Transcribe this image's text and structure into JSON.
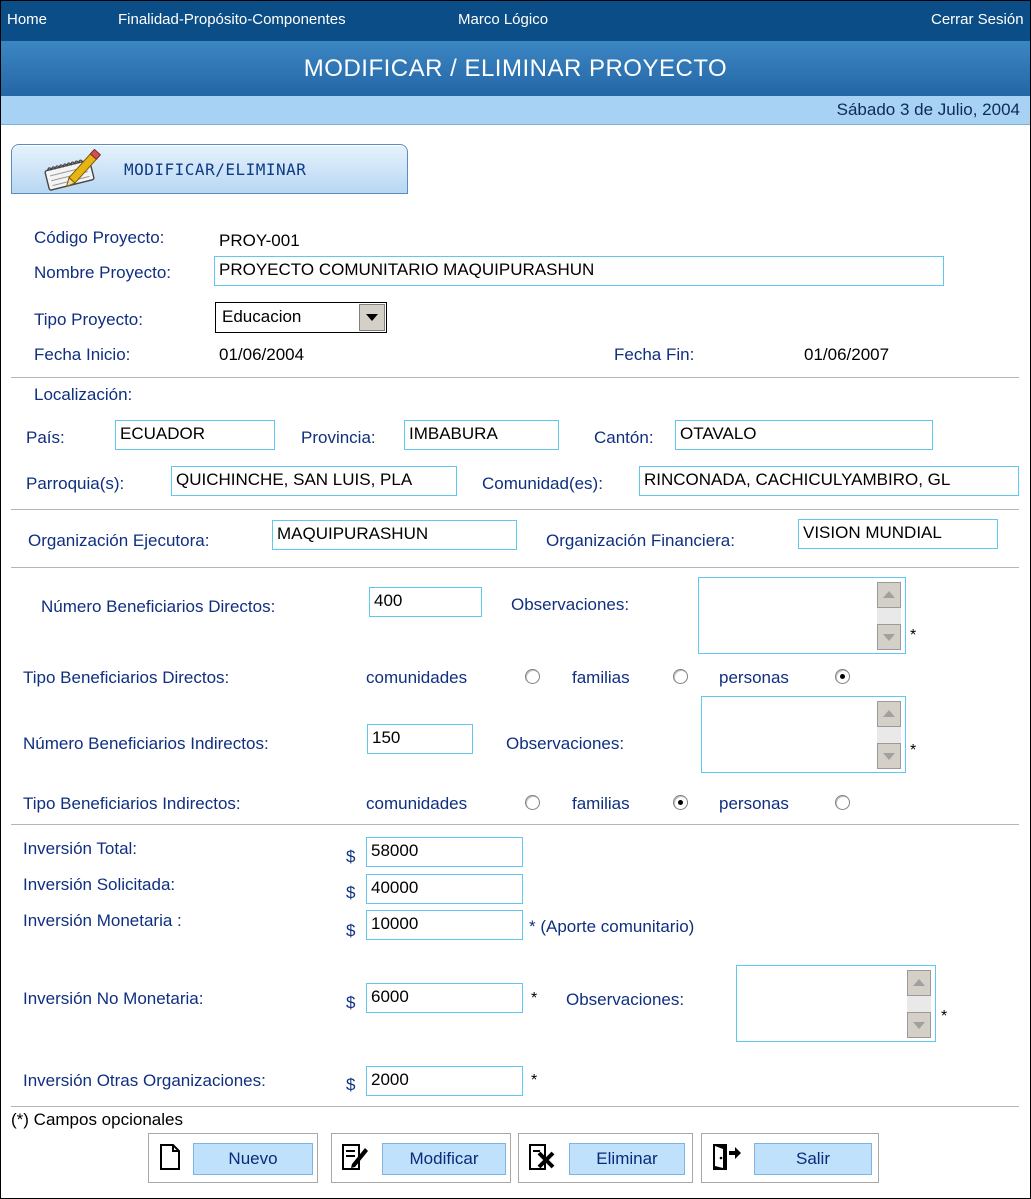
{
  "nav": {
    "home": "Home",
    "finalidad": "Finalidad-Propósito-Componentes",
    "marco": "Marco Lógico",
    "logout": "Cerrar Sesión"
  },
  "header": {
    "title": "MODIFICAR / ELIMINAR PROYECTO",
    "date": "Sábado 3 de Julio, 2004"
  },
  "tab": {
    "title": "MODIFICAR/ELIMINAR"
  },
  "form": {
    "codigo_label": "Código Proyecto:",
    "codigo_value": "PROY-001",
    "nombre_label": "Nombre Proyecto:",
    "nombre_value": "PROYECTO COMUNITARIO MAQUIPURASHUN",
    "tipo_label": "Tipo Proyecto:",
    "tipo_value": "Educacion",
    "fecha_inicio_label": "Fecha Inicio:",
    "fecha_inicio_value": "01/06/2004",
    "fecha_fin_label": "Fecha Fin:",
    "fecha_fin_value": "01/06/2007",
    "localizacion_label": "Localización:",
    "pais_label": "País:",
    "pais_value": "ECUADOR",
    "provincia_label": "Provincia:",
    "provincia_value": "IMBABURA",
    "canton_label": "Cantón:",
    "canton_value": "OTAVALO",
    "parroquia_label": "Parroquia(s):",
    "parroquia_value": "QUICHINCHE, SAN LUIS, PLA",
    "comunidad_label": "Comunidad(es):",
    "comunidad_value": "RINCONADA, CACHICULYAMBIRO, GL",
    "org_ejecutora_label": "Organización Ejecutora:",
    "org_ejecutora_value": "MAQUIPURASHUN",
    "org_financiera_label": "Organización Financiera:",
    "org_financiera_value": "VISION MUNDIAL",
    "benef_directos_label": "Número Beneficiarios Directos:",
    "benef_directos_value": "400",
    "benef_indirectos_label": "Número Beneficiarios Indirectos:",
    "benef_indirectos_value": "150",
    "observaciones_label": "Observaciones:",
    "tipo_directos_label": "Tipo Beneficiarios Directos:",
    "tipo_indirectos_label": "Tipo Beneficiarios Indirectos:",
    "opt_comunidades": "comunidades",
    "opt_familias": "familias",
    "opt_personas": "personas",
    "tipo_directos_selected": "personas",
    "tipo_indirectos_selected": "familias",
    "inv_total_label": "Inversión Total:",
    "inv_total_value": "58000",
    "inv_solicitada_label": "Inversión Solicitada:",
    "inv_solicitada_value": "40000",
    "inv_monetaria_label": "Inversión Monetaria :",
    "inv_monetaria_value": "10000",
    "inv_monetaria_note": "* (Aporte comunitario)",
    "inv_no_monetaria_label": "Inversión No Monetaria:",
    "inv_no_monetaria_value": "6000",
    "inv_otras_label": "Inversión Otras Organizaciones:",
    "inv_otras_value": "2000",
    "currency": "$",
    "asterisk": "*",
    "optional_note": "(*) Campos opcionales"
  },
  "buttons": {
    "nuevo": "Nuevo",
    "modificar": "Modificar",
    "eliminar": "Eliminar",
    "salir": "Salir"
  },
  "icons": {
    "tab": "pencil-notepad-icon",
    "nuevo": "new-document-icon",
    "modificar": "edit-document-icon",
    "eliminar": "delete-document-icon",
    "salir": "exit-door-icon"
  },
  "colors": {
    "nav_bg": "#0b4d86",
    "band_bg": "#2f77b8",
    "date_band": "#a7d2f4",
    "label": "#0f2f80",
    "field_border": "#5fc7f0",
    "button_bg": "#bfe1fb"
  }
}
